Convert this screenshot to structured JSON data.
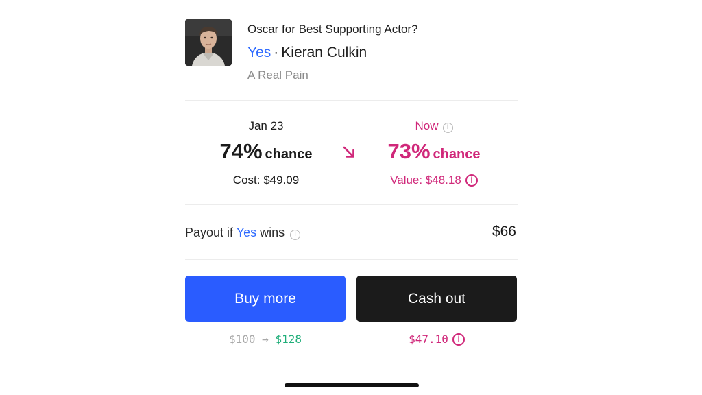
{
  "market": {
    "question": "Oscar for Best Supporting Actor?",
    "outcome": "Yes",
    "separator": "·",
    "nominee": "Kieran Culkin",
    "film": "A Real Pain"
  },
  "comparison": {
    "then": {
      "label": "Jan 23",
      "percent": "74%",
      "chance_word": "chance",
      "cost": "Cost: $49.09"
    },
    "now": {
      "label": "Now",
      "percent": "73%",
      "chance_word": "chance",
      "value": "Value: $48.18"
    },
    "trend_icon": "arrow-down-right-icon"
  },
  "payout": {
    "prefix": "Payout if",
    "outcome": "Yes",
    "suffix": "wins",
    "amount": "$66"
  },
  "actions": {
    "buy_label": "Buy more",
    "cash_label": "Cash out",
    "buy_caption_from": "$100",
    "buy_caption_arrow": "→",
    "buy_caption_to": "$128",
    "cash_caption": "$47.10"
  },
  "colors": {
    "accent_blue": "#2a5cff",
    "loss_pink": "#d0287a",
    "gain_green": "#1fae79",
    "dark_button": "#1b1b1b"
  }
}
